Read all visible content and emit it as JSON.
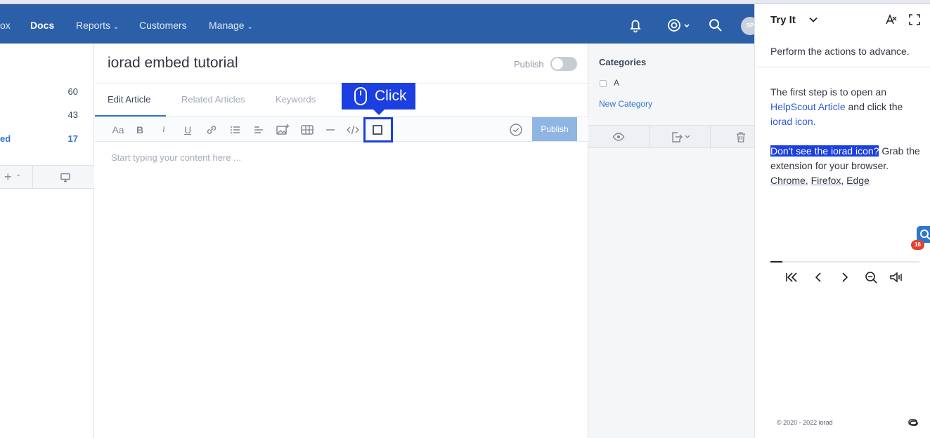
{
  "nav": {
    "partial_item": "ox",
    "items": [
      {
        "label": "Docs",
        "active": true
      },
      {
        "label": "Reports"
      },
      {
        "label": "Customers"
      },
      {
        "label": "Manage"
      }
    ],
    "avatar_initials": "SP"
  },
  "sidebar": {
    "counts": [
      "60",
      "43",
      "17"
    ],
    "partial_label": "ed"
  },
  "editor": {
    "title": "iorad embed tutorial",
    "publish_label": "Publish",
    "publish_toggle_on": false,
    "tabs": [
      "Edit Article",
      "Related Articles",
      "Keywords"
    ],
    "toolbar": {
      "font_label": "Aa",
      "bold_label": "B",
      "italic_label": "i",
      "underline_label": "U",
      "publish_button": "Publish"
    },
    "placeholder": "Start typing your content here ..."
  },
  "callout": {
    "label": "Click"
  },
  "categories": {
    "title": "Categories",
    "items": [
      {
        "label": "A",
        "checked": false
      }
    ],
    "new_category": "New Category"
  },
  "tryit": {
    "title": "Try It",
    "subtext": "Perform the actions to advance.",
    "step_text_1": "The first step is to open an ",
    "step_link_1": "HelpScout Article",
    "step_text_2": " and click the ",
    "step_link_2": "iorad icon.",
    "help_highlight": "Don't see the iorad icon?",
    "help_text": " Grab the extension for your browser.",
    "browsers": [
      "Chrome",
      "Firefox",
      "Edge"
    ],
    "progress_fraction": 0.08,
    "footer": "© 2020 - 2022 iorad",
    "badge_count": "16"
  },
  "colors": {
    "nav_bg": "#2b5fa8",
    "accent": "#1b3fe0",
    "link": "#2e77d0"
  }
}
